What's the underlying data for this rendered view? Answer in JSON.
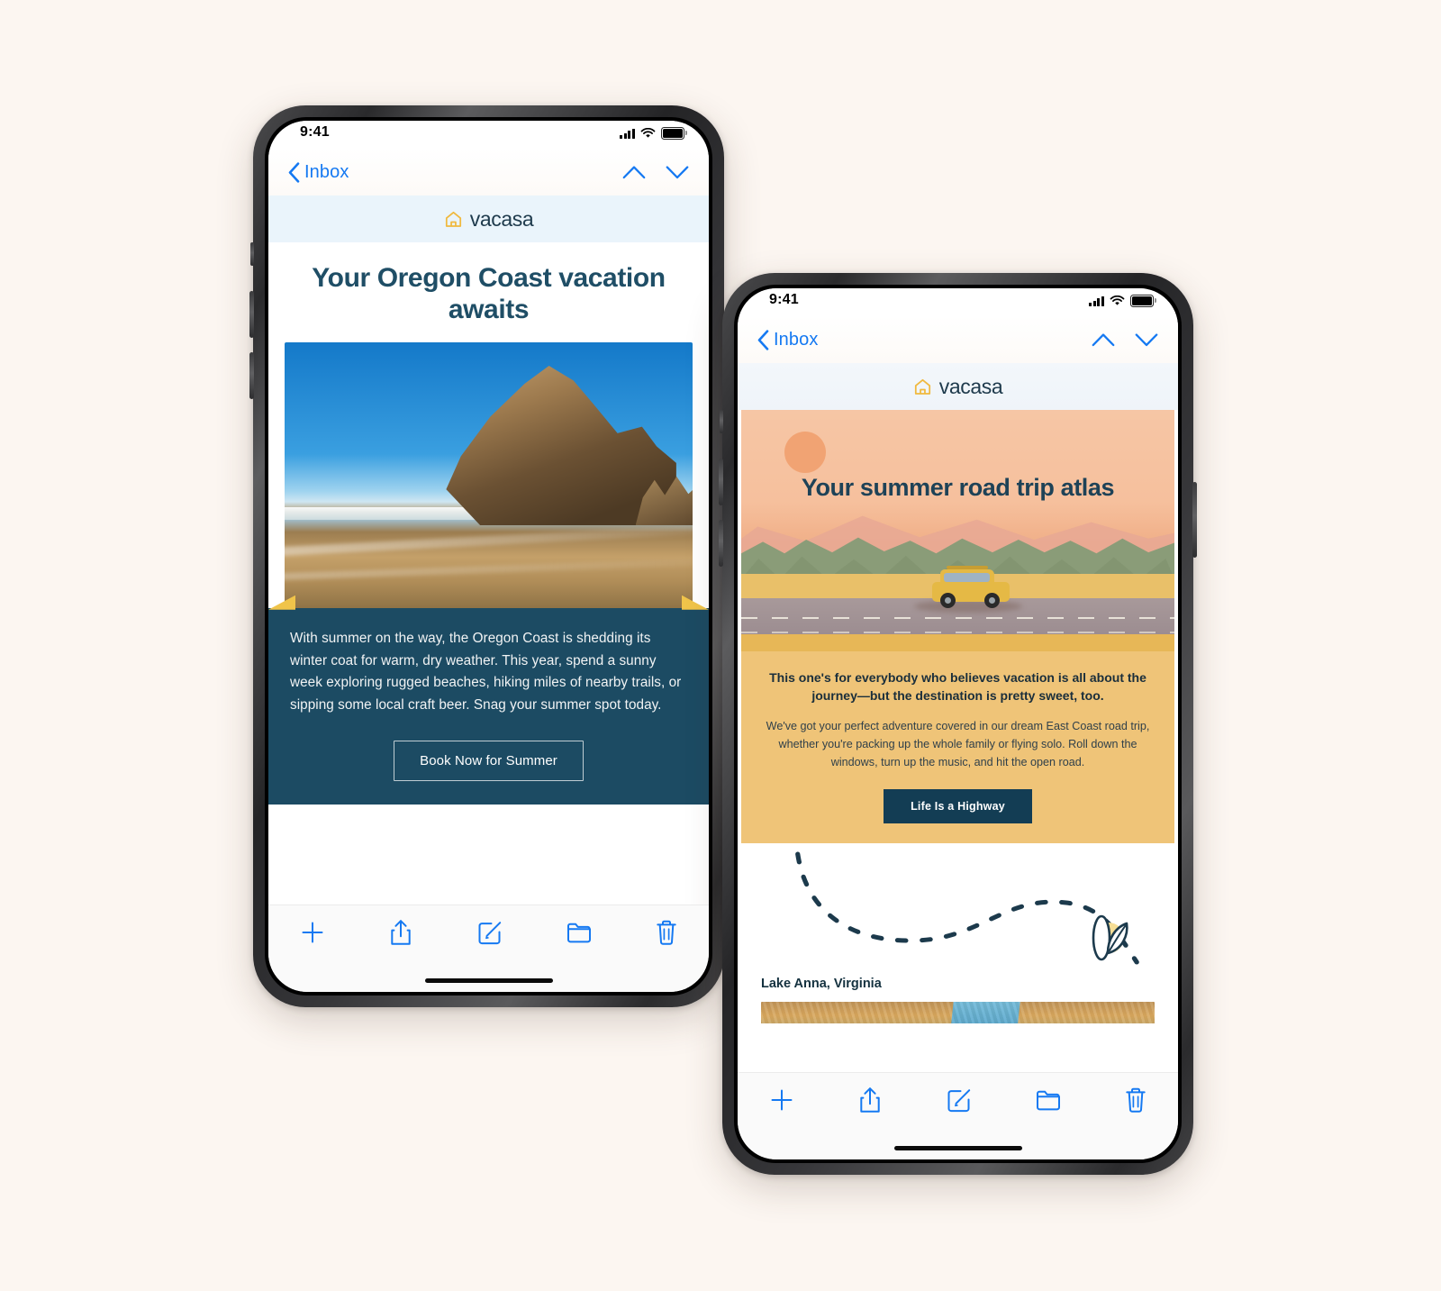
{
  "page": {
    "background_color": "#FCF6F1",
    "accent_blue": "#1579F2",
    "brand_navy": "#1C4B63",
    "brand_yellow": "#EFC478"
  },
  "phones": [
    {
      "id": "phone-left",
      "status_bar": {
        "time": "9:41",
        "cellular_icon": "signal-bars-icon",
        "wifi_icon": "wifi-icon",
        "battery_icon": "battery-icon"
      },
      "mail_nav": {
        "back_icon": "chevron-left-icon",
        "back_label": "Inbox",
        "prev_icon": "chevron-up-icon",
        "next_icon": "chevron-down-icon"
      },
      "email": {
        "brand": {
          "logo_icon": "vacasa-house-icon",
          "logo_text": "vacasa",
          "bar_color": "#EAF4FB"
        },
        "headline": "Your Oregon Coast vacation awaits",
        "hero_image_alt": "haystack-rock-oregon-coast-photo",
        "body": "With summer on the way, the Oregon Coast is shedding its winter coat for warm, dry weather. This year, spend a sunny week exploring rugged beaches, hiking miles of nearby trails, or sipping some local craft beer. Snag your summer spot today.",
        "cta_label": "Book Now for Summer"
      },
      "toolbar": {
        "items": [
          {
            "icon": "plus-icon",
            "name": "compose-new-button"
          },
          {
            "icon": "share-icon",
            "name": "reply-share-button"
          },
          {
            "icon": "compose-icon",
            "name": "compose-button"
          },
          {
            "icon": "folder-icon",
            "name": "move-to-folder-button"
          },
          {
            "icon": "trash-icon",
            "name": "delete-button"
          }
        ]
      },
      "home_indicator": true
    },
    {
      "id": "phone-right",
      "status_bar": {
        "time": "9:41",
        "cellular_icon": "signal-bars-icon",
        "wifi_icon": "wifi-icon",
        "battery_icon": "battery-icon"
      },
      "mail_nav": {
        "back_icon": "chevron-left-icon",
        "back_label": "Inbox",
        "prev_icon": "chevron-up-icon",
        "next_icon": "chevron-down-icon"
      },
      "email": {
        "brand": {
          "logo_icon": "vacasa-house-icon",
          "logo_text": "vacasa",
          "bar_color": "#F3F7FB"
        },
        "headline": "Your summer road trip atlas",
        "hero_image_alt": "illustration-suv-on-highway-at-sunset",
        "lede": "This one's for everybody who believes vacation is all about the journey—but the destination is pretty sweet, too.",
        "body": "We've got your perfect adventure covered in our dream East Coast road trip, whether you're packing up the whole family or flying solo. Roll down the windows, turn up the music, and hit the open road.",
        "cta_label": "Life Is a Highway",
        "route_icon": "dashed-route-line-icon",
        "leaf_icon": "surfboard-leaf-icon",
        "destination_label": "Lake Anna, Virginia",
        "destination_image_alt": "lake-anna-autumn-aerial-photo"
      },
      "toolbar": {
        "items": [
          {
            "icon": "plus-icon",
            "name": "compose-new-button"
          },
          {
            "icon": "share-icon",
            "name": "reply-share-button"
          },
          {
            "icon": "compose-icon",
            "name": "compose-button"
          },
          {
            "icon": "folder-icon",
            "name": "move-to-folder-button"
          },
          {
            "icon": "trash-icon",
            "name": "delete-button"
          }
        ]
      },
      "home_indicator": true
    }
  ]
}
